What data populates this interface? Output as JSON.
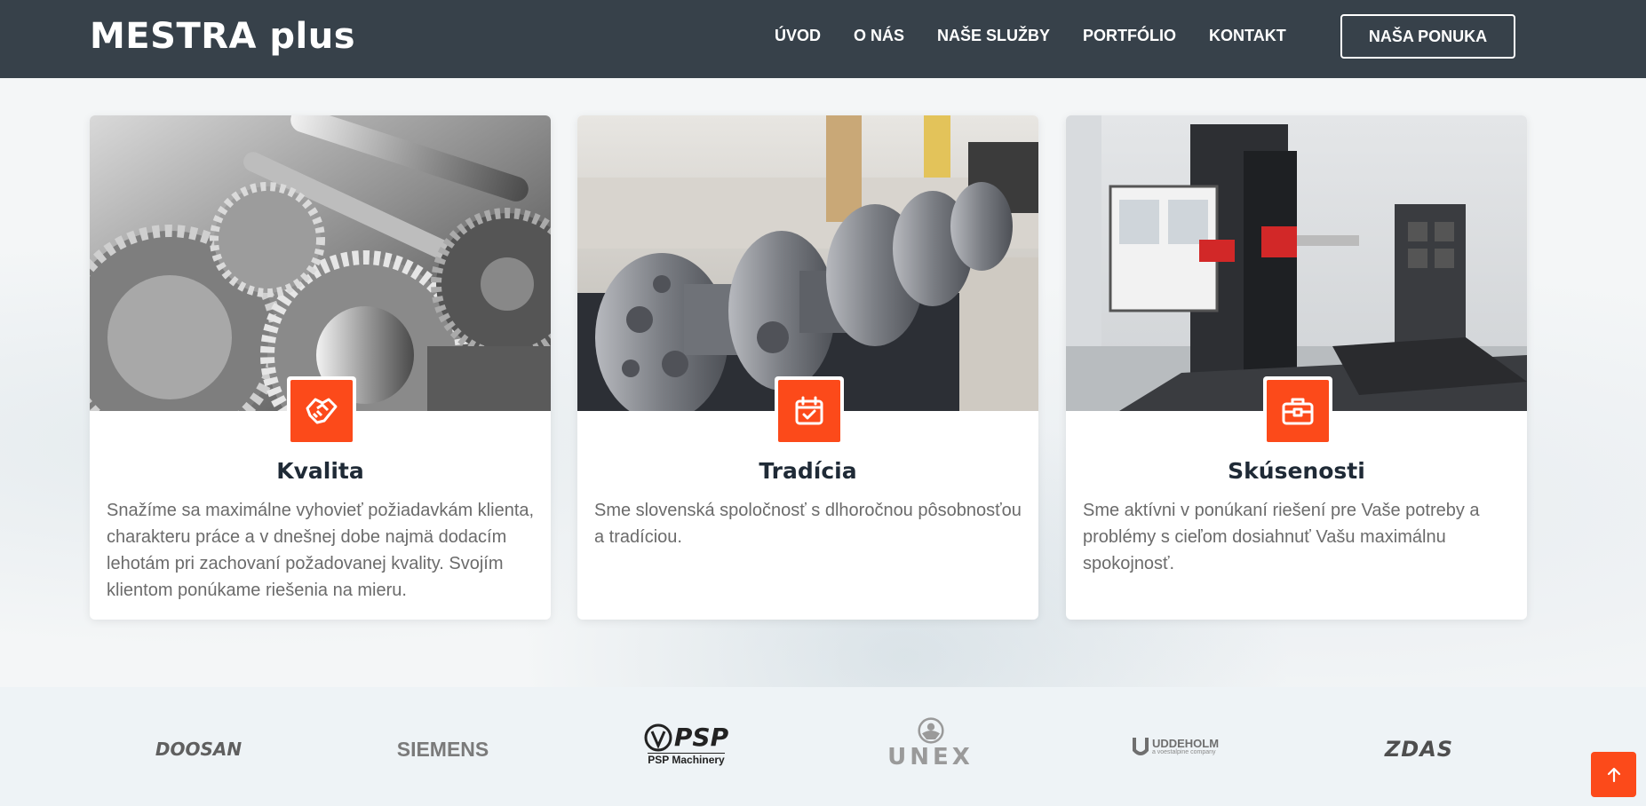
{
  "header": {
    "logo": "MESTRA plus",
    "nav": [
      "ÚVOD",
      "O NÁS",
      "NAŠE SLUŽBY",
      "PORTFÓLIO",
      "KONTAKT"
    ],
    "cta": "NAŠA PONUKA"
  },
  "cards": [
    {
      "title": "Kvalita",
      "text": "Snažíme sa maximálne vyhovieť požiadavkám klienta, charakteru práce a v dnešnej dobe najmä dodacím lehotám pri zachovaní požadovanej kvality. Svojím klientom ponúkame riešenia na mieru.",
      "icon": "handshake-icon",
      "image": "gears-photo"
    },
    {
      "title": "Tradícia",
      "text": "Sme slovenská spoločnosť s dlhoročnou pôsobnosťou a tradíciou.",
      "icon": "calendar-check-icon",
      "image": "crankshaft-photo"
    },
    {
      "title": "Skúsenosti",
      "text": "Sme aktívni v ponúkaní riešení pre Vaše potreby a problémy s cieľom dosiahnuť Vašu maximálnu spokojnosť.",
      "icon": "briefcase-icon",
      "image": "cnc-machine-photo"
    }
  ],
  "brands": [
    "DOOSAN",
    "SIEMENS",
    "PSP",
    "PSP Machinery",
    "UNEX",
    "UDDEHOLM",
    "a voestalpine company",
    "ZDAS"
  ],
  "colors": {
    "accent": "#fc4a1a",
    "header": "#37414a",
    "title": "#1f2a36",
    "text": "#6b6b6b"
  }
}
